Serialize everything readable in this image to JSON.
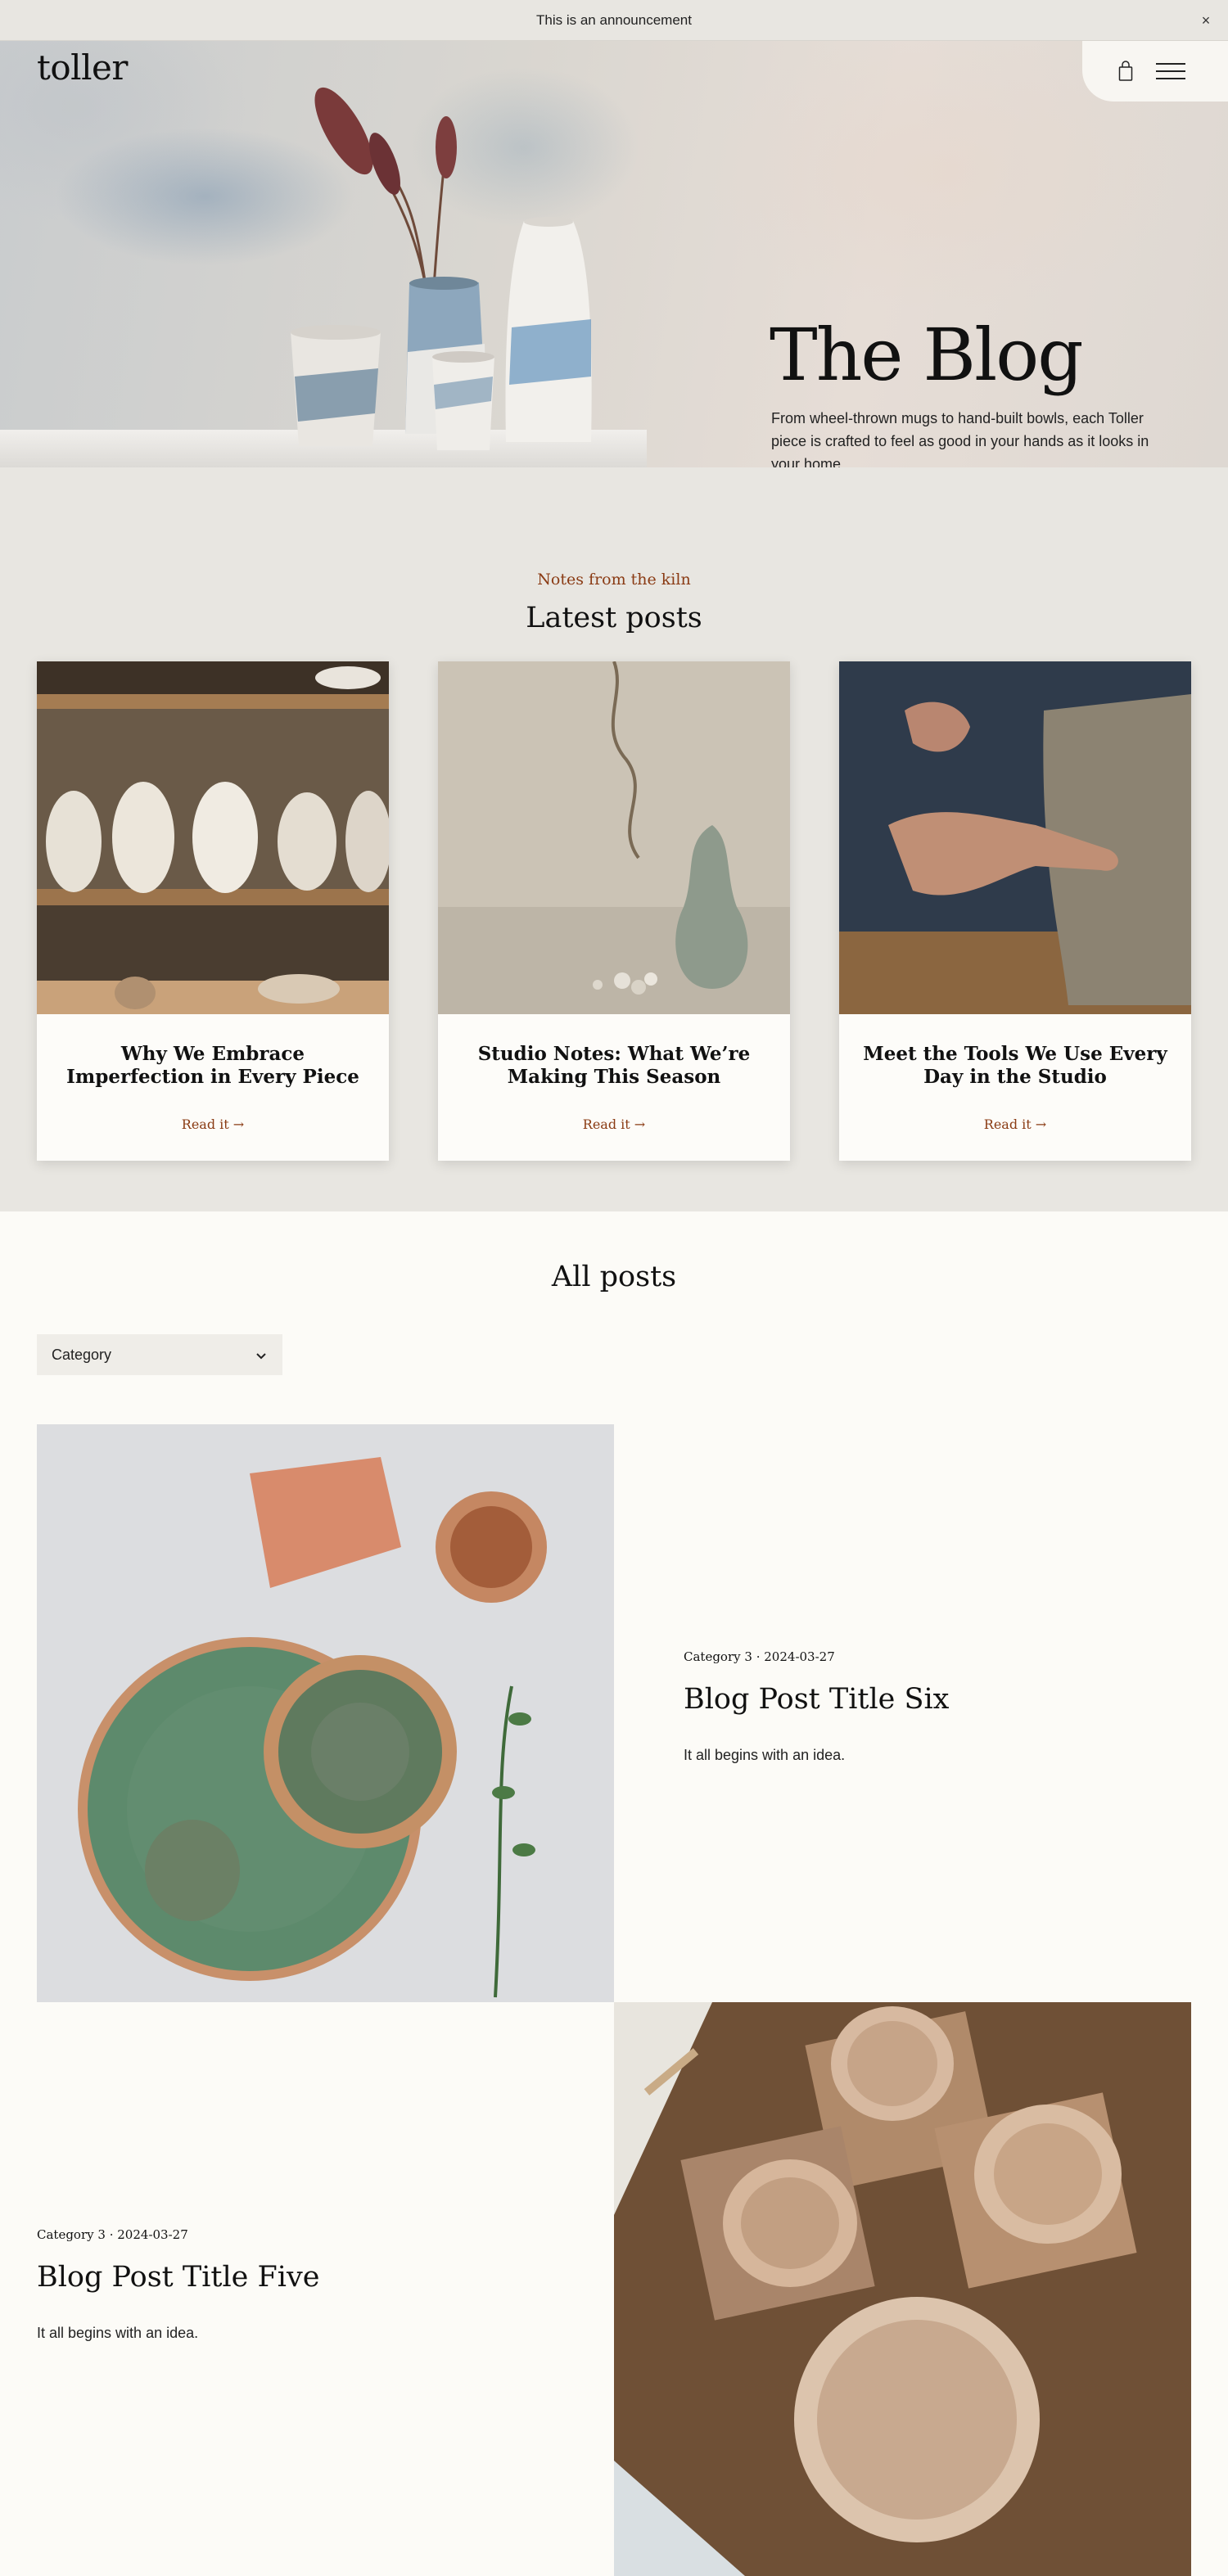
{
  "announcement": {
    "text": "This is an announcement",
    "close_label": "×"
  },
  "header": {
    "logo": "toller",
    "cart_icon": "bag-icon",
    "menu_icon": "hamburger-menu-icon"
  },
  "hero": {
    "title": "The Blog",
    "subtitle": "From wheel-thrown mugs to hand-built bowls, each Toller piece is crafted to feel as good in your hands as it looks in your home."
  },
  "latest": {
    "eyebrow": "Notes from the kiln",
    "title": "Latest posts",
    "cards": [
      {
        "title": "Why We Embrace Imperfection in Every Piece",
        "link": "Read it →"
      },
      {
        "title": "Studio Notes: What We’re Making This Season",
        "link": "Read it →"
      },
      {
        "title": "Meet the Tools We Use Every Day in the Studio",
        "link": "Read it →"
      }
    ]
  },
  "all_posts": {
    "title": "All posts",
    "filter": {
      "label": "Category",
      "icon": "chevron-down-icon"
    },
    "posts": [
      {
        "category": "Category 3",
        "separator": "·",
        "date": "2024-03-27",
        "title": "Blog Post Title Six",
        "excerpt": "It all begins with an idea."
      },
      {
        "category": "Category 3",
        "separator": "·",
        "date": "2024-03-27",
        "title": "Blog Post Title Five",
        "excerpt": "It all begins with an idea."
      }
    ]
  },
  "colors": {
    "accent": "#8a3b14",
    "section_bg": "#e8e6e1",
    "page_bg": "#fcfbf7"
  }
}
